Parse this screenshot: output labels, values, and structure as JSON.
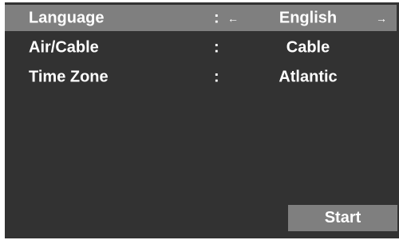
{
  "settings": {
    "rows": [
      {
        "label": "Language",
        "separator": ":",
        "value": "English",
        "left_arrow": "←",
        "right_arrow": "→"
      },
      {
        "label": "Air/Cable",
        "separator": ":",
        "value": "Cable"
      },
      {
        "label": "Time Zone",
        "separator": ":",
        "value": "Atlantic"
      }
    ]
  },
  "footer": {
    "start_label": "Start"
  },
  "colors": {
    "panel_bg": "#323232",
    "highlight": "#7f7f7f",
    "text": "#ffffff"
  }
}
